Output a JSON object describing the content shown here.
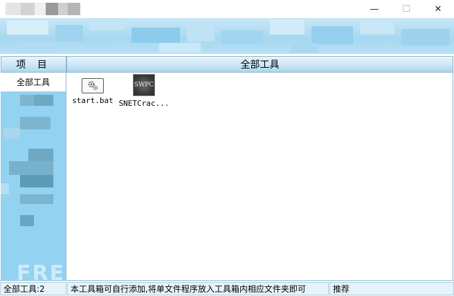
{
  "window": {
    "controls": {
      "minimize": "—",
      "maximize": "☐",
      "close": "✕"
    }
  },
  "header": {
    "left_title": "项 目",
    "right_title": "全部工具"
  },
  "sidebar": {
    "items": [
      {
        "label": "全部工具",
        "selected": true
      }
    ]
  },
  "tools": [
    {
      "label": "start.bat",
      "icon": "gear-file-icon"
    },
    {
      "label": "SNETCrac...",
      "icon": "swpc-app-icon",
      "icon_text": "SWPC"
    }
  ],
  "statusbar": {
    "count": "全部工具:2",
    "hint": "本工具箱可自行添加,将单文件程序放入工具箱内相应文件夹即可",
    "recommend": "推荐"
  },
  "watermark": "FREEBUF",
  "colors": {
    "accent": "#93d2f0",
    "header_top": "#e7f4fb",
    "header_bottom": "#a9d6ef"
  }
}
